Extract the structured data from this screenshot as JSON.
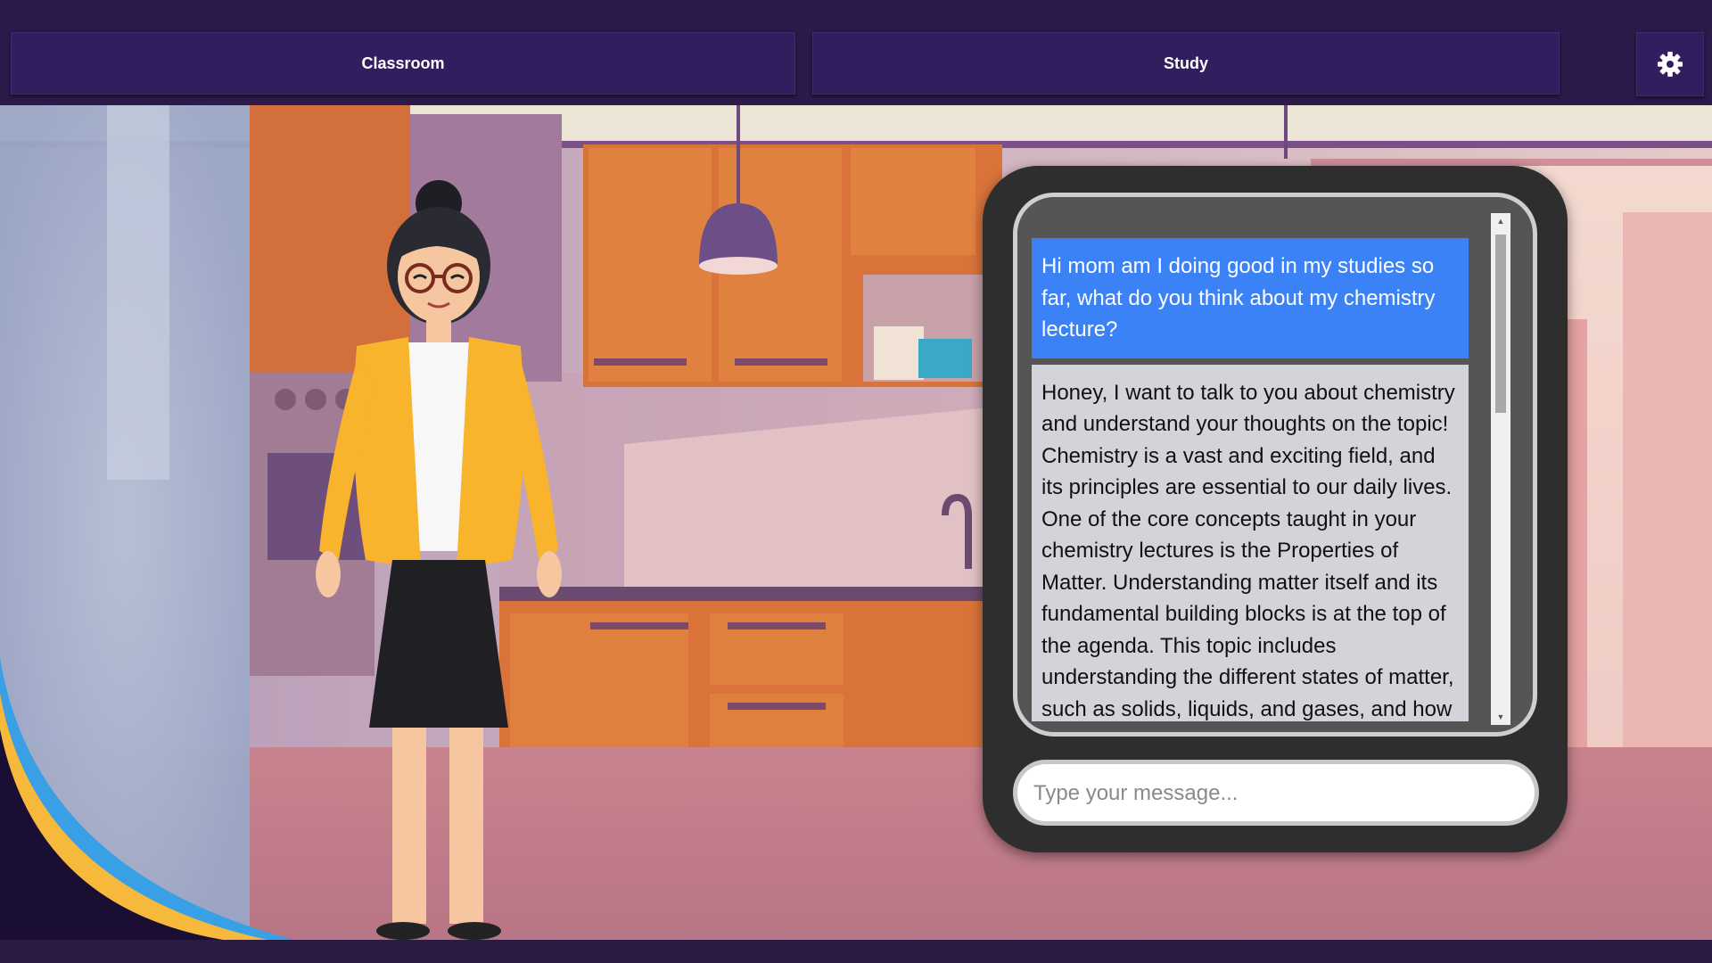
{
  "nav": {
    "classroom_label": "Classroom",
    "study_label": "Study",
    "settings_icon": "gear-icon"
  },
  "chat": {
    "messages": [
      {
        "role": "user",
        "text": "Hi mom am I doing good in my studies so far, what do you think about my chemistry lecture?"
      },
      {
        "role": "mom",
        "text": "Honey, I want to talk to you about chemistry and understand your thoughts on the topic! Chemistry is a vast and exciting field, and its principles are essential to our daily lives. One of the core concepts taught in your chemistry lectures is the Properties of Matter. Understanding matter itself and its fundamental building blocks is at the top of the agenda. This topic includes understanding the different states of matter, such as solids, liquids, and gases, and how they can be changed through various"
      }
    ],
    "input_placeholder": "Type your message..."
  },
  "colors": {
    "topbar": "#2b1a4a",
    "nav_button": "#321e5e",
    "user_bubble": "#3b82f6",
    "mom_bubble": "#d2d4da"
  }
}
